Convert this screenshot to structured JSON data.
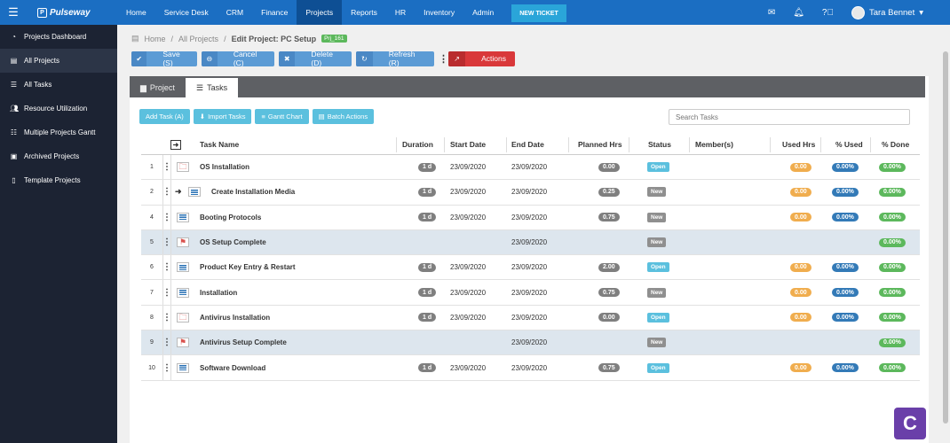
{
  "topbar": {
    "brand": "Pulseway",
    "nav": [
      "Home",
      "Service Desk",
      "CRM",
      "Finance",
      "Projects",
      "Reports",
      "HR",
      "Inventory",
      "Admin"
    ],
    "active_nav": "Projects",
    "new_ticket": "NEW TICKET",
    "user_name": "Tara Bennet",
    "icons": [
      "menu-icon",
      "mail-icon",
      "bell-icon",
      "help-icon",
      "chevron-down-icon"
    ]
  },
  "sidebar": {
    "items": [
      {
        "label": "Projects Dashboard",
        "icon": "dashboard-icon"
      },
      {
        "label": "All Projects",
        "icon": "list-icon",
        "active": true
      },
      {
        "label": "All Tasks",
        "icon": "tasks-icon"
      },
      {
        "label": "Resource Utilization",
        "icon": "users-icon"
      },
      {
        "label": "Multiple Projects Gantt",
        "icon": "sliders-icon"
      },
      {
        "label": "Archived Projects",
        "icon": "archive-icon"
      },
      {
        "label": "Template Projects",
        "icon": "file-icon"
      }
    ]
  },
  "breadcrumb": {
    "home": "Home",
    "all_projects": "All Projects",
    "current": "Edit Project: PC Setup",
    "badge": "Prj_161"
  },
  "toolbar": {
    "save": "Save (S)",
    "cancel": "Cancel (C)",
    "delete": "Delete (D)",
    "refresh": "Refresh (R)",
    "actions": "Actions"
  },
  "tabs": [
    {
      "label": "Project",
      "active": false
    },
    {
      "label": "Tasks",
      "active": true
    }
  ],
  "task_actions": {
    "add_task": "Add Task (A)",
    "import_tasks": "Import Tasks",
    "gantt_chart": "Gantt Chart",
    "batch_actions": "Batch Actions",
    "search_placeholder": "Search Tasks"
  },
  "table": {
    "headers": {
      "task_name": "Task Name",
      "duration": "Duration",
      "start_date": "Start Date",
      "end_date": "End Date",
      "planned_hrs": "Planned Hrs",
      "status": "Status",
      "members": "Member(s)",
      "used_hrs": "Used Hrs",
      "pct_used": "% Used",
      "pct_done": "% Done"
    },
    "rows": [
      {
        "num": "1",
        "type": "folder",
        "name": "OS Installation",
        "duration": "1 d",
        "start": "23/09/2020",
        "end": "23/09/2020",
        "planned": "0.00",
        "status": "Open",
        "used": "0.00",
        "pct_used": "0.00%",
        "pct_done": "0.00%"
      },
      {
        "num": "2",
        "type": "doc",
        "indent": true,
        "name": "Create Installation Media",
        "duration": "1 d",
        "start": "23/09/2020",
        "end": "23/09/2020",
        "planned": "0.25",
        "status": "New",
        "used": "0.00",
        "pct_used": "0.00%",
        "pct_done": "0.00%"
      },
      {
        "num": "4",
        "type": "doc",
        "name": "Booting Protocols",
        "duration": "1 d",
        "start": "23/09/2020",
        "end": "23/09/2020",
        "planned": "0.75",
        "status": "New",
        "used": "0.00",
        "pct_used": "0.00%",
        "pct_done": "0.00%"
      },
      {
        "num": "5",
        "type": "milestone",
        "name": "OS Setup Complete",
        "duration": "",
        "start": "",
        "end": "23/09/2020",
        "planned": "",
        "status": "New",
        "used": "",
        "pct_used": "",
        "pct_done": "0.00%"
      },
      {
        "num": "6",
        "type": "doc",
        "name": "Product Key Entry & Restart",
        "duration": "1 d",
        "start": "23/09/2020",
        "end": "23/09/2020",
        "planned": "2.00",
        "status": "Open",
        "used": "0.00",
        "pct_used": "0.00%",
        "pct_done": "0.00%"
      },
      {
        "num": "7",
        "type": "doc",
        "name": "Installation",
        "duration": "1 d",
        "start": "23/09/2020",
        "end": "23/09/2020",
        "planned": "0.75",
        "status": "New",
        "used": "0.00",
        "pct_used": "0.00%",
        "pct_done": "0.00%"
      },
      {
        "num": "8",
        "type": "folder",
        "name": "Antivirus Installation",
        "duration": "1 d",
        "start": "23/09/2020",
        "end": "23/09/2020",
        "planned": "0.00",
        "status": "Open",
        "used": "0.00",
        "pct_used": "0.00%",
        "pct_done": "0.00%"
      },
      {
        "num": "9",
        "type": "milestone",
        "name": "Antivirus Setup Complete",
        "duration": "",
        "start": "",
        "end": "23/09/2020",
        "planned": "",
        "status": "New",
        "used": "",
        "pct_used": "",
        "pct_done": "0.00%"
      },
      {
        "num": "10",
        "type": "doc",
        "name": "Software Download",
        "duration": "1 d",
        "start": "23/09/2020",
        "end": "23/09/2020",
        "planned": "0.75",
        "status": "Open",
        "used": "0.00",
        "pct_used": "0.00%",
        "pct_done": "0.00%"
      }
    ]
  },
  "colors": {
    "topbar": "#1b6ec2",
    "sidebar": "#1c2333",
    "toolbar_button": "#5b9bd5",
    "actions_button": "#d9383a",
    "milestone_row": "#dde6ee",
    "help_button": "#6a3fa9"
  },
  "help_button": {
    "label": "C"
  }
}
